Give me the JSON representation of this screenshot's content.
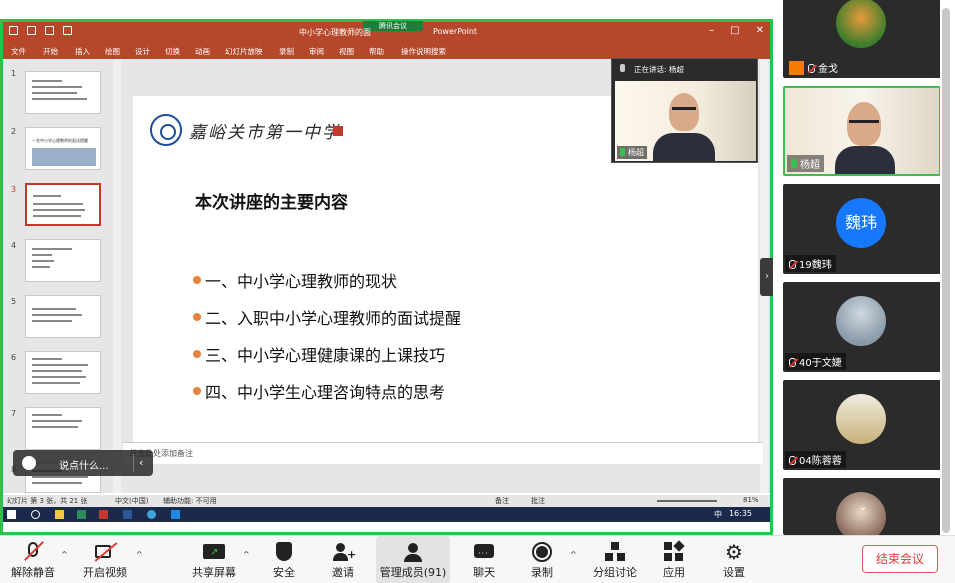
{
  "window": {
    "title": "中小学心理教师的面试提醒.pptx - PowerPoint",
    "title_short": "中小学心理教师的面",
    "app": "PowerPoint",
    "meeting_tag": "腾讯会议"
  },
  "ribbon": {
    "tabs": [
      "文件",
      "开始",
      "插入",
      "绘图",
      "设计",
      "切换",
      "动画",
      "幻灯片放映",
      "录制",
      "审阅",
      "视图",
      "帮助",
      "操作说明搜索"
    ]
  },
  "thumbnails": {
    "numbers": [
      "1",
      "2",
      "3",
      "4",
      "5",
      "6",
      "7",
      "8"
    ],
    "thumb2_title": "一名中小学心理教师的面试提醒"
  },
  "slide": {
    "school_name": "嘉峪关市第一中学",
    "title": "本次讲座的主要内容",
    "bullets": [
      "一、中小学心理教师的现状",
      "二、入职中小学心理教师的面试提醒",
      "三、中小学心理健康课的上课技巧",
      "四、中小学生心理咨询特点的思考"
    ]
  },
  "notes": {
    "placeholder": "单击此处添加备注"
  },
  "ppt_status": {
    "slide_info": "幻灯片 第 3 张，共 21 张",
    "language": "中文(中国)",
    "accessibility": "辅助功能: 不可用",
    "notes_btn": "备注",
    "comments_btn": "批注",
    "zoom": "81%"
  },
  "taskbar": {
    "ime": "中",
    "time": "16:35"
  },
  "speaker": {
    "speaking_label": "正在讲话: 杨超",
    "name": "杨超"
  },
  "chat": {
    "placeholder": "说点什么..."
  },
  "participants": [
    {
      "name": "金戈"
    },
    {
      "name": "杨超"
    },
    {
      "name": "19魏玮",
      "avatar_text": "魏玮"
    },
    {
      "name": "40于文婕"
    },
    {
      "name": "04陈蓉蓉"
    }
  ],
  "toolbar": {
    "unmute": "解除静音",
    "video": "开启视频",
    "share": "共享屏幕",
    "security": "安全",
    "invite": "邀请",
    "members": "管理成员(91)",
    "chat": "聊天",
    "record": "录制",
    "breakout": "分组讨论",
    "apps": "应用",
    "settings": "设置",
    "end": "结束会议"
  },
  "colors": {
    "ppt_accent": "#b7472a",
    "share_border": "#29c24a",
    "end_button": "#e03a3a",
    "avatar_blue": "#1677ff"
  }
}
